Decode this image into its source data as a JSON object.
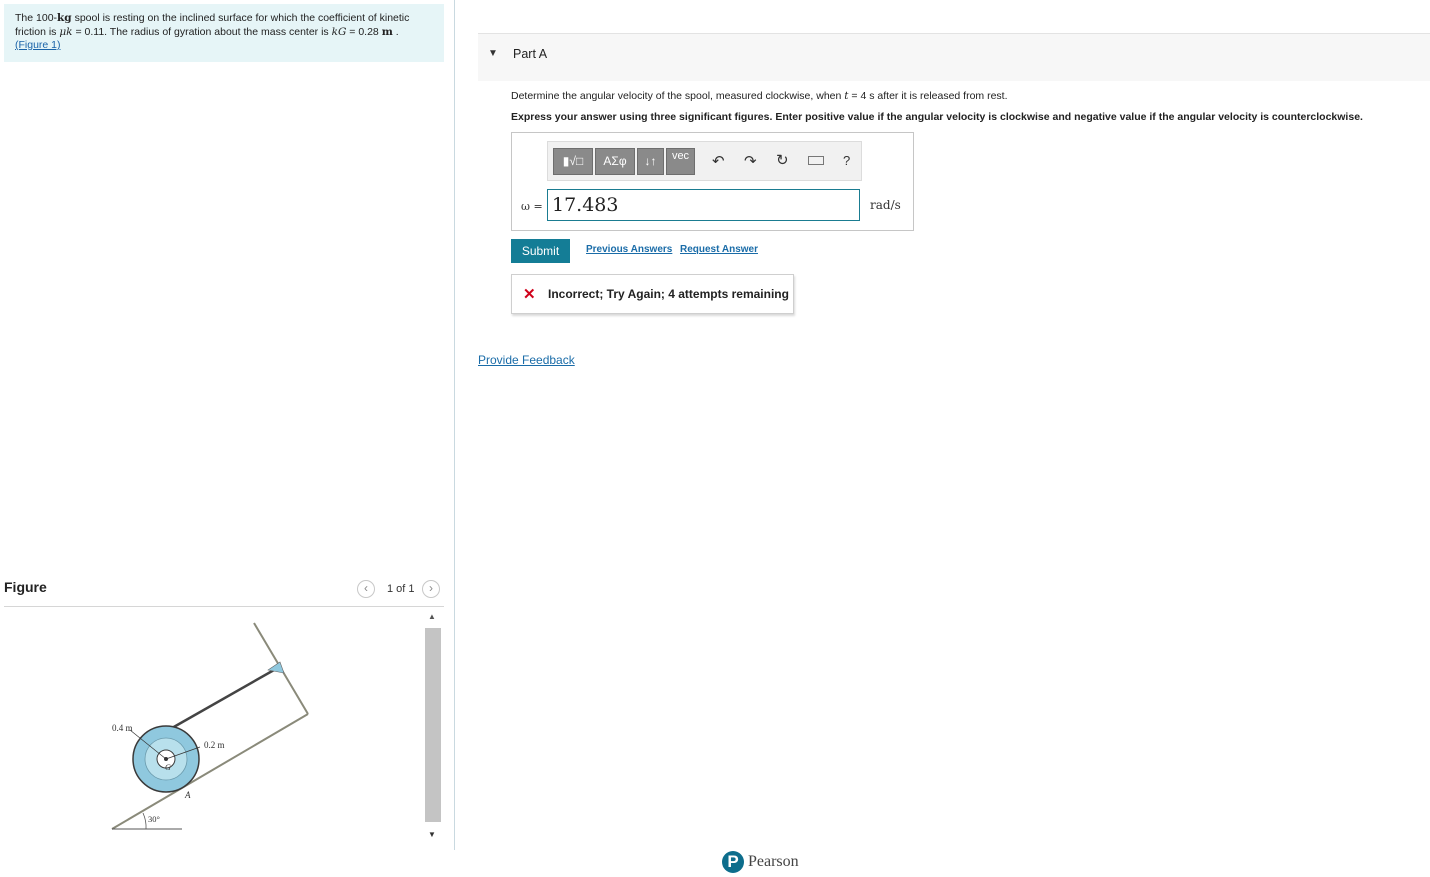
{
  "problem": {
    "text_1": "The 100-",
    "mass_unit": "kg",
    "text_2": " spool is resting on the inclined surface for which the coefficient of kinetic friction is ",
    "mu_symbol": "μk",
    "text_3": " = 0.11. The radius of gyration about the mass center is ",
    "k_symbol": "kG",
    "text_4": " = 0.28  ",
    "length_unit": "m",
    "text_5": " .",
    "figure_link": "(Figure 1)"
  },
  "figure_panel": {
    "title": "Figure",
    "pager_text": "1 of 1",
    "prev_icon": "‹",
    "next_icon": "›",
    "labels": {
      "outer_radius": "0.4 m",
      "inner_radius": "0.2 m",
      "center": "G",
      "contact": "A",
      "angle": "30°"
    }
  },
  "part": {
    "title": "Part A",
    "question_1": "Determine the angular velocity of the spool, measured clockwise, when ",
    "t_symbol": "t",
    "question_2": " = 4  s after it is released from rest.",
    "instructions": "Express your answer using three significant figures. Enter positive value if the angular velocity is clockwise and negative value if the angular velocity is counterclockwise."
  },
  "toolbar": {
    "templates": "▮√□",
    "greek": "ΑΣφ",
    "arrows": "↓↑",
    "vec": "vec",
    "undo": "↶",
    "redo": "↷",
    "reset": "↻",
    "help": "?"
  },
  "answer": {
    "variable_label": "ω =",
    "value": "17.483",
    "unit": "rad/s"
  },
  "actions": {
    "submit": "Submit",
    "previous_answers": "Previous Answers",
    "request_answer": "Request Answer"
  },
  "feedback": {
    "icon": "✕",
    "message": "Incorrect; Try Again; 4 attempts remaining"
  },
  "provide_feedback": "Provide Feedback",
  "brand": {
    "logo_letter": "P",
    "name": "Pearson"
  },
  "colors": {
    "accent": "#147d96",
    "link": "#1a6ca8",
    "error": "#d0021b",
    "problem_bg": "#e6f5f7",
    "spool": "#8fc8de"
  }
}
